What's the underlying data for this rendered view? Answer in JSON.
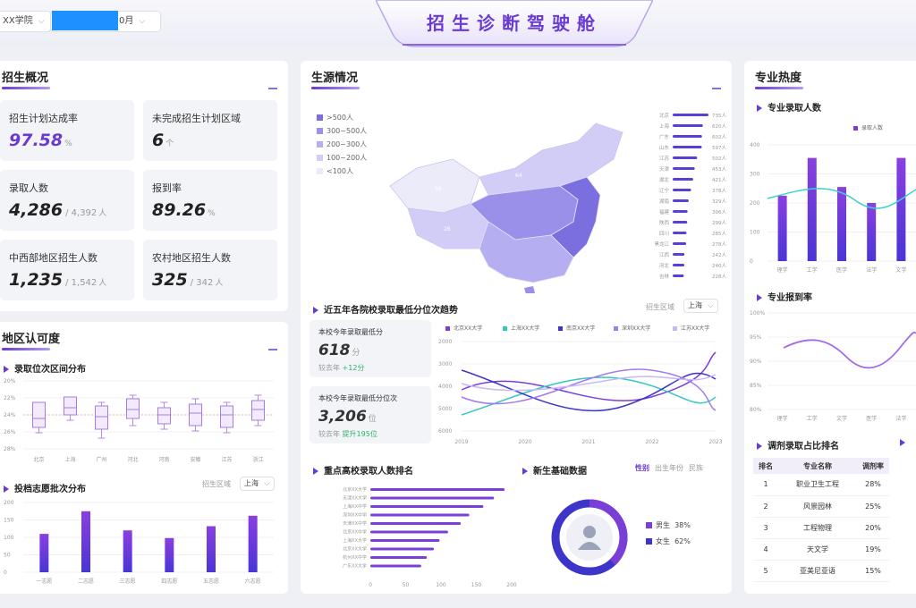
{
  "header": {
    "title": "招生诊断驾驶舱",
    "selector1": "XX学院",
    "selector2": "0月"
  },
  "overview": {
    "title": "招生概况",
    "kpis": [
      {
        "label": "招生计划达成率",
        "value": "97.58",
        "unit": "%"
      },
      {
        "label": "未完成招生计划区域",
        "value": "6",
        "unit": "个"
      },
      {
        "label": "录取人数",
        "value": "4,286",
        "sub": "/ 4,392",
        "unit": "人"
      },
      {
        "label": "报到率",
        "value": "89.26",
        "unit": "%"
      },
      {
        "label": "中西部地区招生人数",
        "value": "1,235",
        "sub": "/ 1,542",
        "unit": "人"
      },
      {
        "label": "农村地区招生人数",
        "value": "325",
        "sub": "/ 342",
        "unit": "人"
      }
    ]
  },
  "region": {
    "title": "地区认可度",
    "box_title": "录取位次区间分布",
    "box_y": [
      "20%",
      "22%",
      "24%",
      "26%",
      "28%"
    ],
    "box_x": [
      "北京",
      "上海",
      "广州",
      "河北",
      "河南",
      "安徽",
      "江苏",
      "浙江"
    ],
    "bar_title": "投档志愿批次分布",
    "bar_region_label": "招生区域",
    "bar_region_value": "上海",
    "bar_y": [
      "200",
      "150",
      "100",
      "50",
      "0"
    ],
    "bar_x": [
      "一志愿",
      "二志愿",
      "三志愿",
      "四志愿",
      "五志愿",
      "六志愿"
    ],
    "bar_values": [
      110,
      175,
      120,
      98,
      132,
      162
    ]
  },
  "source": {
    "title": "生源情况",
    "map_legend": [
      ">500人",
      "300~500人",
      "200~300人",
      "100~200人",
      "<100人"
    ],
    "map_legend_colors": [
      "#7b6fe0",
      "#9a90ea",
      "#b5aef0",
      "#d2cdf6",
      "#ecebfa"
    ],
    "map_labels": [
      "58",
      "64",
      "26"
    ],
    "ranking": [
      {
        "name": "北京",
        "value": "735人"
      },
      {
        "name": "上海",
        "value": "620人"
      },
      {
        "name": "广东",
        "value": "602人"
      },
      {
        "name": "山东",
        "value": "597人"
      },
      {
        "name": "江苏",
        "value": "502人"
      },
      {
        "name": "天津",
        "value": "453人"
      },
      {
        "name": "湖北",
        "value": "421人"
      },
      {
        "name": "辽宁",
        "value": "378人"
      },
      {
        "name": "湖南",
        "value": "329人"
      },
      {
        "name": "福建",
        "value": "306人"
      },
      {
        "name": "陕西",
        "value": "299人"
      },
      {
        "name": "四川",
        "value": "285人"
      },
      {
        "name": "黑龙江",
        "value": "278人"
      },
      {
        "name": "江西",
        "value": "242人"
      },
      {
        "name": "河北",
        "value": "240人"
      },
      {
        "name": "吉林",
        "value": "228人"
      }
    ],
    "ranking_values": [
      735,
      620,
      602,
      597,
      502,
      453,
      421,
      378,
      329,
      306,
      299,
      285,
      278,
      242,
      240,
      228
    ]
  },
  "trend": {
    "title": "近五年各院校录取最低分位次趋势",
    "region_label": "招生区域",
    "region_value": "上海",
    "card1_label": "本校今年录取最低分",
    "card1_value": "618",
    "card1_unit": "分",
    "card1_compare": "较去年",
    "card1_delta": "+12分",
    "card2_label": "本校今年录取最低分位次",
    "card2_value": "3,206",
    "card2_unit": "位",
    "card2_compare": "较去年",
    "card2_delta": "提升195位",
    "legend": [
      "北京XX大学",
      "上海XX大学",
      "南京XX大学",
      "深圳XX大学",
      "江苏XX大学"
    ],
    "legend_colors": [
      "#7a3fd6",
      "#33c8c0",
      "#3d35c9",
      "#a37af0",
      "#c9b8f5"
    ],
    "y_ticks": [
      "2000",
      "3000",
      "4000",
      "5000",
      "6000"
    ],
    "x_ticks": [
      "2019",
      "2020",
      "2021",
      "2022",
      "2023"
    ]
  },
  "keyschool": {
    "title": "重点高校录取人数排名",
    "schools": [
      "北京XX大学",
      "天津XX大学",
      "上海XX中学",
      "深圳XX中学",
      "天津XX中学",
      "北京XX中学",
      "上海XX大学",
      "北京XX大学",
      "杭州XX中学",
      "广东XX大学"
    ],
    "values": [
      190,
      175,
      160,
      140,
      128,
      110,
      98,
      90,
      80,
      72
    ],
    "x_ticks": [
      "0",
      "50",
      "100",
      "150",
      "200"
    ]
  },
  "newstudent": {
    "title": "新生基础数据",
    "tabs": [
      "性别",
      "出生年份",
      "民族"
    ],
    "male_label": "男生",
    "male_pct": "38%",
    "female_label": "女生",
    "female_pct": "62%",
    "male_share": 0.38
  },
  "major": {
    "title": "专业热度",
    "enroll_title": "专业录取人数",
    "enroll_legend": "录取人数",
    "enroll_y": [
      "400",
      "300",
      "200",
      "100",
      "0"
    ],
    "enroll_x": [
      "理学",
      "工学",
      "医学",
      "法学",
      "文学"
    ],
    "enroll_values": [
      225,
      355,
      255,
      200,
      355
    ],
    "rate_title": "专业报到率",
    "rate_y": [
      "100%",
      "95%",
      "90%",
      "85%",
      "80%"
    ],
    "rate_x": [
      "理学",
      "工学",
      "文学",
      "医学",
      "法学"
    ],
    "adjust_title": "调剂录取占比排名",
    "adjust_cols": [
      "排名",
      "专业名称",
      "调剂率"
    ],
    "adjust_rows": [
      [
        "1",
        "职业卫生工程",
        "28%"
      ],
      [
        "2",
        "风景园林",
        "25%"
      ],
      [
        "3",
        "工程物理",
        "20%"
      ],
      [
        "4",
        "天文学",
        "19%"
      ],
      [
        "5",
        "亚美尼亚语",
        "15%"
      ]
    ]
  }
}
